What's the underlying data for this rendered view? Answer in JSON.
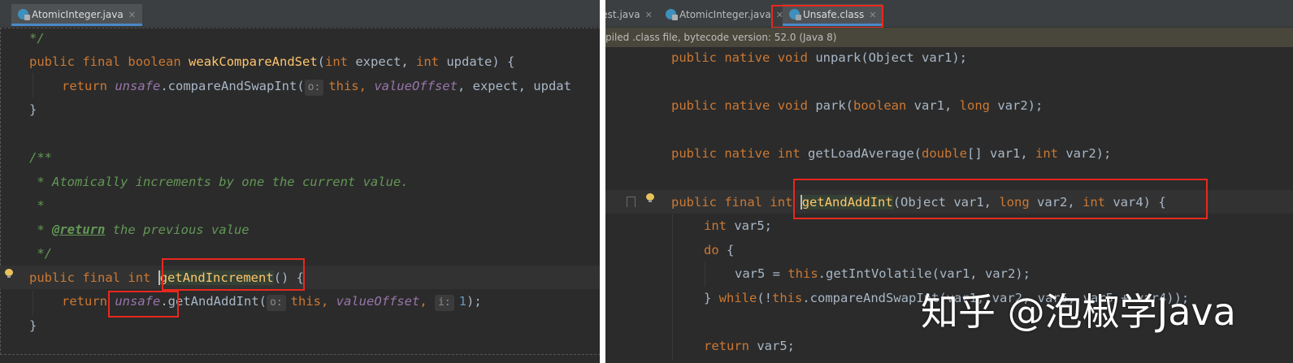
{
  "left_pane": {
    "tabs": [
      {
        "label": "AtomicInteger.java",
        "close": "✕"
      }
    ],
    "lines": {
      "l0": {
        "comment": "*/"
      },
      "l1": {
        "kw1": "public",
        "kw2": "final",
        "kw3": "boolean",
        "method": "weakCompareAndSet",
        "p1": "(",
        "t1": "int",
        "a1": " expect, ",
        "t2": "int",
        "a2": " update) {"
      },
      "l2": {
        "kw": "return",
        "field": "unsafe",
        "call": ".compareAndSwapInt(",
        "hint": "o:",
        "kw_this": "this",
        "sep1": ", ",
        "field2": "valueOffset",
        "rest": ", expect, updat"
      },
      "l3": {
        "brace": "}"
      },
      "l5": {
        "comment": "/**"
      },
      "l6": {
        "comment": " * Atomically increments by one the current value."
      },
      "l7": {
        "comment": " *"
      },
      "l8": {
        "star": " * ",
        "tag": "@return",
        "rest": " the previous value"
      },
      "l9": {
        "comment": " */"
      },
      "l10": {
        "kw1": "public",
        "kw2": "final",
        "kw3": "int",
        "method": "getAndIncrement",
        "rest": "() {"
      },
      "l11": {
        "kw": "return",
        "field": "unsafe",
        "call": ".getAndAddInt(",
        "hint": "o:",
        "kw_this": "this",
        "sep1": ", ",
        "field2": "valueOffset",
        "sep2": ",",
        "hint2": "i:",
        "num": "1",
        "end": ");"
      },
      "l12": {
        "brace": "}"
      }
    }
  },
  "right_pane": {
    "tabs": [
      {
        "label": "Test.java",
        "close": "✕"
      },
      {
        "label": "AtomicInteger.java",
        "close": "✕"
      },
      {
        "label": "Unsafe.class",
        "close": "✕"
      }
    ],
    "info_banner": "piled .class file, bytecode version: 52.0 (Java 8)",
    "lines": {
      "r1": {
        "kw1": "public",
        "kw2": "native",
        "kw3": "void",
        "method": " unpark(Object var1);"
      },
      "r2": {
        "kw1": "public",
        "kw2": "native",
        "kw3": "void",
        "method": " park(",
        "t1": "boolean",
        "a1": " var1, ",
        "t2": "long",
        "a2": " var2);"
      },
      "r3": {
        "kw1": "public",
        "kw2": "native",
        "kw3": "int",
        "method": " getLoadAverage(",
        "t1": "double",
        "a1": "[] var1, ",
        "t2": "int",
        "a2": " var2);"
      },
      "r4": {
        "kw1": "public",
        "kw2": "final",
        "kw3": "int",
        "method": "getAndAddInt",
        "a0": "(Object var1, ",
        "t1": "long",
        "a1": " var2, ",
        "t2": "int",
        "a2": " var4) {"
      },
      "r5": {
        "kw": "int",
        "rest": " var5;"
      },
      "r6": {
        "kw": "do",
        "rest": " {"
      },
      "r7": {
        "pre": "var5 = ",
        "kw_this": "this",
        "rest": ".getIntVolatile(var1, var2);"
      },
      "r8": {
        "pre": "} ",
        "kw": "while",
        "p": "(!",
        "kw_this": "this",
        "rest": ".compareAndSwapInt(var1, var2, var5, var5 + var4));"
      },
      "r9": {
        "kw": "return",
        "rest": " var5;"
      }
    }
  },
  "watermark": {
    "text": "知乎 @泡椒学Java"
  },
  "colors": {
    "editor_bg": "#2b2b2b",
    "keyword": "#cc7832",
    "method": "#ffc66d",
    "field": "#9876aa",
    "comment": "#629755",
    "number": "#6897bb",
    "highlight_box": "#e8281e"
  }
}
